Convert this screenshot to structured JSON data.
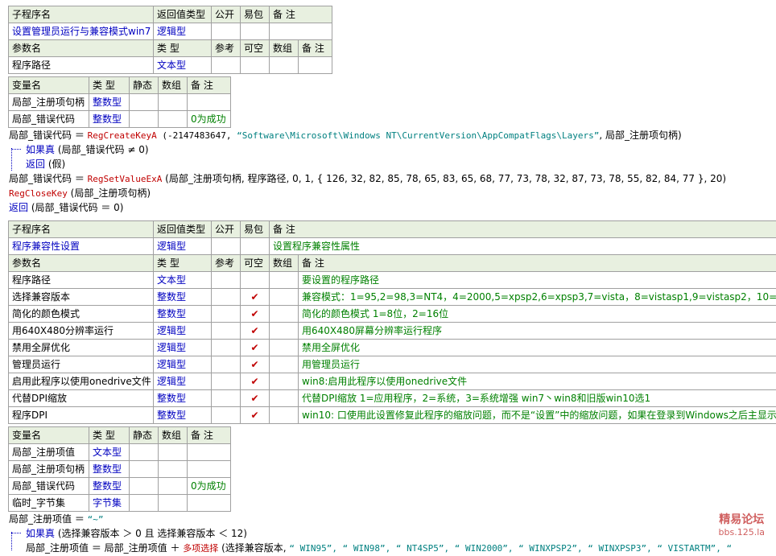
{
  "sub1": {
    "header": [
      "子程序名",
      "返回值类型",
      "公开",
      "易包",
      "备 注"
    ],
    "row": [
      "设置管理员运行与兼容模式win7",
      "逻辑型",
      "",
      "",
      ""
    ],
    "param_header": [
      "参数名",
      "类 型",
      "参考",
      "可空",
      "数组",
      "备 注"
    ],
    "params": [
      [
        "程序路径",
        "文本型",
        "",
        "",
        "",
        ""
      ]
    ]
  },
  "vars1": {
    "header": [
      "变量名",
      "类 型",
      "静态",
      "数组",
      "备 注"
    ],
    "rows": [
      [
        "局部_注册项句柄",
        "整数型",
        "",
        "",
        ""
      ],
      [
        "局部_错误代码",
        "整数型",
        "",
        "",
        "0为成功"
      ]
    ]
  },
  "code1": {
    "l1_a": "局部_错误代码 ＝ ",
    "l1_fn": "RegCreateKeyA",
    "l1_b": " (-2147483647, ",
    "l1_str": "“Software\\Microsoft\\Windows NT\\CurrentVersion\\AppCompatFlags\\Layers”",
    "l1_c": ", 局部_注册项句柄)",
    "l2_kw": "如果真",
    "l2_rest": " (局部_错误代码 ≠ 0)",
    "l3_kw": "返回",
    "l3_rest": " (假)",
    "l4_a": "局部_错误代码 ＝ ",
    "l4_fn": "RegSetValueExA",
    "l4_b": " (局部_注册项句柄, 程序路径, 0, 1, { 126, 32, 82, 85, 78, 65, 83, 65, 68, 77, 73, 78, 32, 87, 73, 78, 55, 82, 84, 77 }, 20)",
    "l5_fn": "RegCloseKey",
    "l5_rest": " (局部_注册项句柄)",
    "l6_kw": "返回",
    "l6_rest": " (局部_错误代码 ＝ 0)"
  },
  "sub2": {
    "header": [
      "子程序名",
      "返回值类型",
      "公开",
      "易包",
      "备 注"
    ],
    "row": [
      "程序兼容性设置",
      "逻辑型",
      "",
      "",
      "设置程序兼容性属性"
    ],
    "param_header": [
      "参数名",
      "类 型",
      "参考",
      "可空",
      "数组",
      "备 注"
    ],
    "params": [
      [
        "程序路径",
        "文本型",
        "",
        "",
        "",
        "要设置的程序路径"
      ],
      [
        "选择兼容版本",
        "整数型",
        "",
        "✔",
        "",
        "兼容模式：1=95,2=98,3=NT4，4=2000,5=xpsp2,6=xpsp3,7=vista，8=vistasp1,9=vistasp2，10=win7,11=win8"
      ],
      [
        "简化的颜色模式",
        "整数型",
        "",
        "✔",
        "",
        "简化的颜色模式 1=8位，2=16位"
      ],
      [
        "用640X480分辨率运行",
        "逻辑型",
        "",
        "✔",
        "",
        "用640X480屏幕分辨率运行程序"
      ],
      [
        "禁用全屏优化",
        "逻辑型",
        "",
        "✔",
        "",
        "禁用全屏优化"
      ],
      [
        "管理员运行",
        "逻辑型",
        "",
        "✔",
        "",
        "用管理员运行"
      ],
      [
        "启用此程序以使用onedrive文件",
        "逻辑型",
        "",
        "✔",
        "",
        "win8:启用此程序以使用onedrive文件"
      ],
      [
        "代替DPI缩放",
        "整数型",
        "",
        "✔",
        "",
        "代替DPI缩放 1=应用程序，2=系统，3=系统增强 win7丶win8和旧版win10选1"
      ],
      [
        "程序DPI",
        "整数型",
        "",
        "✔",
        "",
        "win10: 口使用此设置修复此程序的缩放问题，而不是“设置”中的缩放问题，如果在登录到Windows之后主显示"
      ]
    ]
  },
  "vars2": {
    "header": [
      "变量名",
      "类 型",
      "静态",
      "数组",
      "备 注"
    ],
    "rows": [
      [
        "局部_注册项值",
        "文本型",
        "",
        "",
        ""
      ],
      [
        "局部_注册项句柄",
        "整数型",
        "",
        "",
        ""
      ],
      [
        "局部_错误代码",
        "整数型",
        "",
        "",
        "0为成功"
      ],
      [
        "临时_字节集",
        "字节集",
        "",
        "",
        ""
      ]
    ]
  },
  "code2": {
    "l1_a": "局部_注册项值 ＝ ",
    "l1_str": "“~”",
    "l2_kw": "如果真",
    "l2_rest": " (选择兼容版本 ＞ 0 且 选择兼容版本 ＜ 12)",
    "l3_a": "局部_注册项值 ＝ 局部_注册项值 ＋ ",
    "l3_fn": "多项选择",
    "l3_b": " (选择兼容版本, ",
    "l3_str": "“ WIN95”, “ WIN98”, “ NT4SP5”, “ WIN2000”, “ WINXPSP2”, “ WINXPSP3”, “ VISTARTM”, “"
  },
  "watermark": {
    "line1": "精易论坛",
    "line2": "bbs.125.la"
  }
}
